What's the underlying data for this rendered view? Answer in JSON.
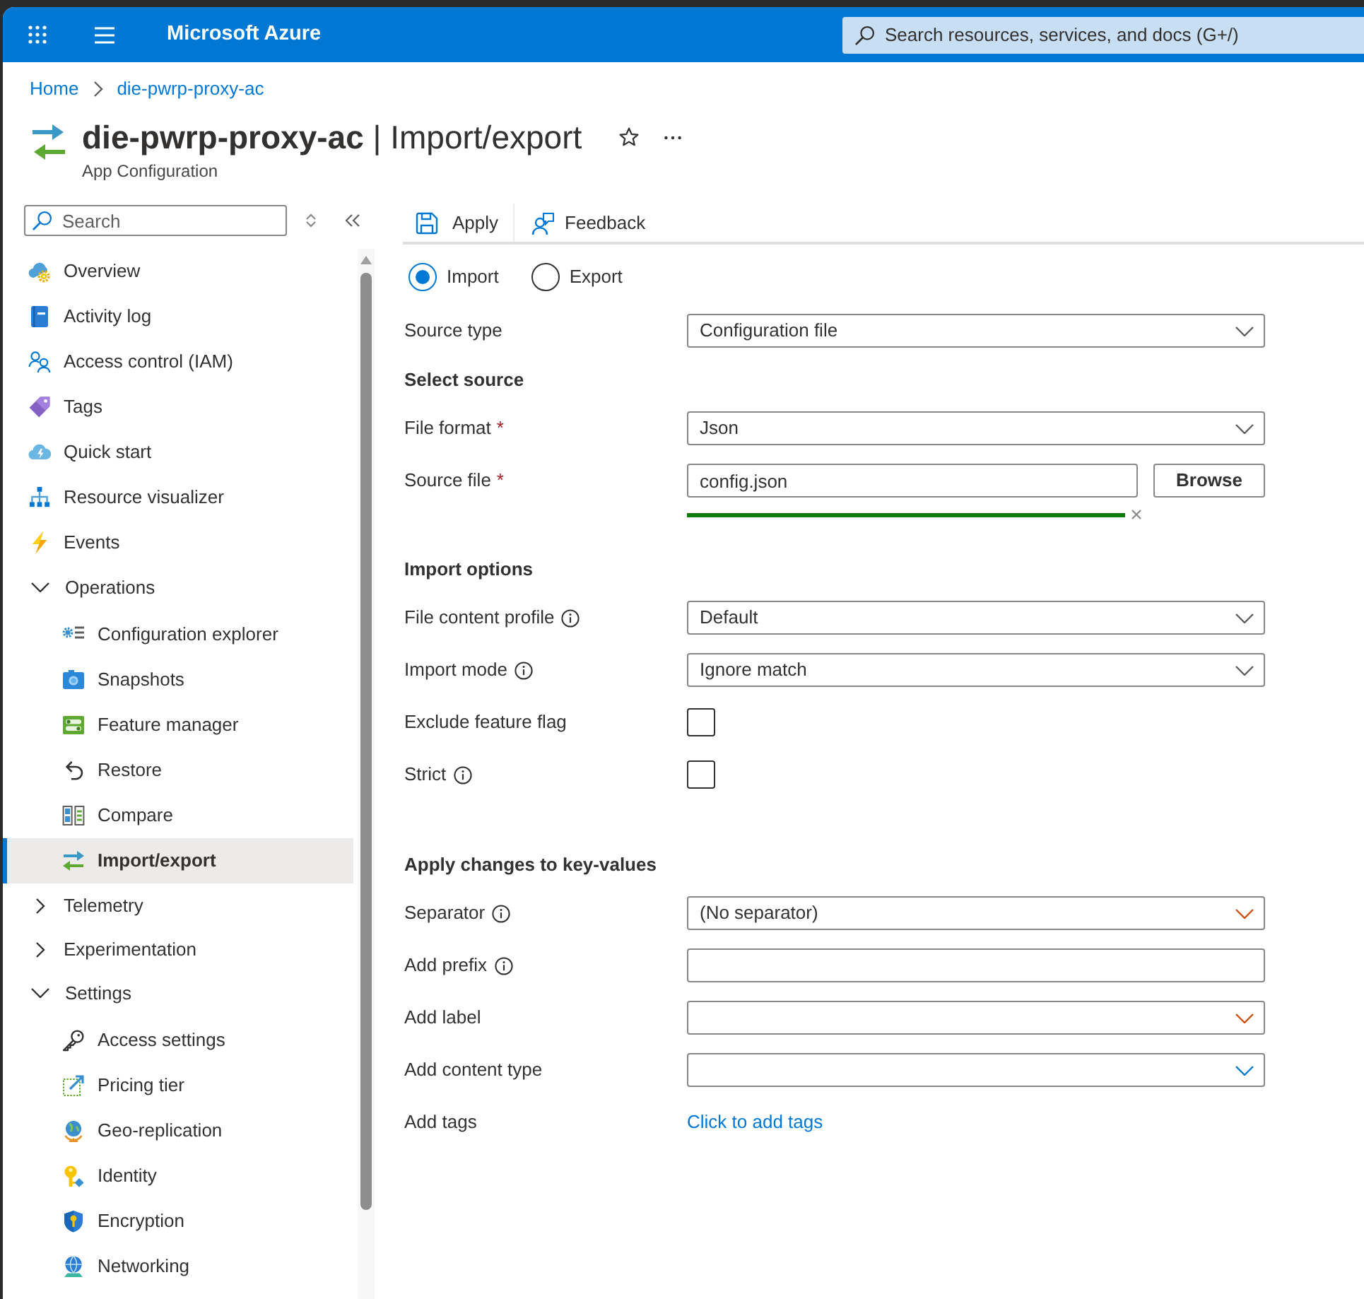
{
  "top_bar": {
    "brand": "Microsoft Azure",
    "search_placeholder": "Search resources, services, and docs (G+/)"
  },
  "breadcrumb": [
    "Home",
    "die-pwrp-proxy-ac"
  ],
  "page_header": {
    "title": "**die-pwrp-proxy-ac** | Import/export",
    "subtitle": "App Configuration"
  },
  "sidebar": {
    "search_placeholder": "Search",
    "items": [
      {
        "label": "Overview",
        "kind": "link",
        "selected": false
      },
      {
        "label": "Activity log",
        "kind": "link",
        "selected": false
      },
      {
        "label": "Access control (IAM)",
        "kind": "link",
        "selected": false
      },
      {
        "label": "Tags",
        "kind": "link",
        "selected": false
      },
      {
        "label": "Quick start",
        "kind": "link",
        "selected": false
      },
      {
        "label": "Resource visualizer",
        "kind": "link",
        "selected": false
      },
      {
        "label": "Events",
        "kind": "link",
        "selected": false
      },
      {
        "label": "Operations",
        "kind": "group",
        "selected": false,
        "expanded": true,
        "children": [
          {
            "label": "Configuration explorer",
            "kind": "link",
            "selected": false
          },
          {
            "label": "Snapshots",
            "kind": "link",
            "selected": false
          },
          {
            "label": "Feature manager",
            "kind": "link",
            "selected": false
          },
          {
            "label": "Restore",
            "kind": "link",
            "selected": false
          },
          {
            "label": "Compare",
            "kind": "link",
            "selected": false
          },
          {
            "label": "Import/export",
            "kind": "link",
            "selected": true
          }
        ]
      },
      {
        "label": "Telemetry",
        "kind": "group",
        "selected": false,
        "expanded": false
      },
      {
        "label": "Experimentation",
        "kind": "group",
        "selected": false,
        "expanded": false
      },
      {
        "label": "Settings",
        "kind": "group",
        "selected": false,
        "expanded": true,
        "children": [
          {
            "label": "Access settings",
            "kind": "link",
            "selected": false
          },
          {
            "label": "Pricing tier",
            "kind": "link",
            "selected": false
          },
          {
            "label": "Geo-replication",
            "kind": "link",
            "selected": false
          },
          {
            "label": "Identity",
            "kind": "link",
            "selected": false
          },
          {
            "label": "Encryption",
            "kind": "link",
            "selected": false
          },
          {
            "label": "Networking",
            "kind": "link",
            "selected": false
          }
        ]
      }
    ]
  },
  "toolbar": [
    {
      "label": "Apply"
    },
    {
      "label": "Feedback"
    }
  ],
  "mode_options": [
    {
      "label": "Import",
      "selected": true
    },
    {
      "label": "Export",
      "selected": false
    }
  ],
  "form": {
    "sections": [
      {
        "fields": [
          {
            "label": "Source type",
            "kind": "dropdown",
            "info": false,
            "value": "Configuration file",
            "color": "#605e5c"
          }
        ]
      },
      {
        "heading": "Select source",
        "fields": [
          {
            "label": "File format",
            "kind": "dropdown",
            "required_mark": "*",
            "info": false,
            "value": "Json",
            "color": "#605e5c"
          },
          {
            "label": "Source file",
            "kind": "file",
            "required_mark": "*",
            "info": false,
            "value": "config.json",
            "button": "Browse",
            "level": 1
          }
        ]
      },
      {
        "heading": "Import options",
        "fields": [
          {
            "label": "File content profile",
            "kind": "dropdown",
            "info": true,
            "value": "Default",
            "color": "#605e5c"
          },
          {
            "label": "Import mode",
            "kind": "dropdown",
            "info": true,
            "value": "Ignore match",
            "color": "#605e5c"
          },
          {
            "label": "Exclude feature flag",
            "kind": "checkbox",
            "info": false,
            "checked": false
          },
          {
            "label": "Strict",
            "kind": "checkbox",
            "info": true,
            "checked": false
          }
        ]
      },
      {
        "heading": "Apply changes to key-values",
        "fields": [
          {
            "label": "Separator",
            "kind": "dropdown",
            "info": true,
            "value": "(No separator)",
            "color": "#ca5010"
          },
          {
            "label": "Add prefix",
            "kind": "text",
            "info": true
          },
          {
            "label": "Add label",
            "kind": "dropdown",
            "info": false,
            "color": "#ca5010"
          },
          {
            "label": "Add content type",
            "kind": "dropdown",
            "info": false,
            "color": "#0078d4"
          },
          {
            "label": "Add tags",
            "kind": "link",
            "info": false,
            "link_text": "Click to add tags"
          }
        ]
      }
    ]
  }
}
